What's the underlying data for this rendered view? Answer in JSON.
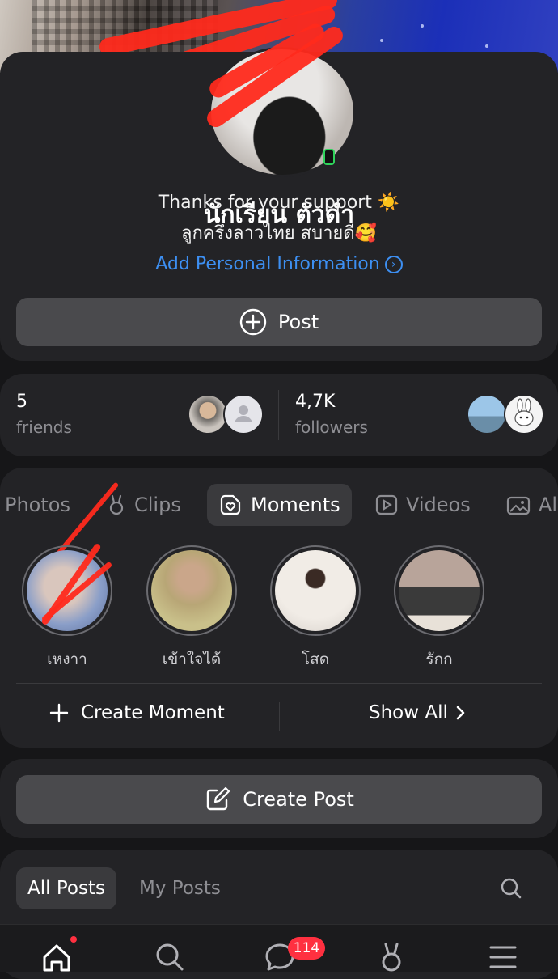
{
  "profile": {
    "name": "นักเรียน ตัวดำ",
    "bio_line1": "Thanks for your support ☀️",
    "bio_line2": "ลูกครึ่งลาวไทย สบายดี🥰",
    "add_info_label": "Add Personal Information",
    "post_button": "Post"
  },
  "stats": {
    "friends_count": "5",
    "friends_label": "friends",
    "followers_count": "4,7K",
    "followers_label": "followers"
  },
  "tabs": [
    {
      "label": "Photos",
      "icon": "photos-icon"
    },
    {
      "label": "Clips",
      "icon": "clips-icon"
    },
    {
      "label": "Moments",
      "icon": "moments-icon",
      "active": true
    },
    {
      "label": "Videos",
      "icon": "videos-icon"
    },
    {
      "label": "Al",
      "icon": "albums-icon"
    }
  ],
  "moments": [
    {
      "label": "เหงาา",
      "color": "#b9a7a0"
    },
    {
      "label": "เข้าใจได้",
      "color": "#c4b48a"
    },
    {
      "label": "โสด",
      "color": "#e8e2dc"
    },
    {
      "label": "รักก",
      "color": "#9c8c86"
    }
  ],
  "moment_actions": {
    "create_label": "Create Moment",
    "show_all_label": "Show All"
  },
  "create_post_label": "Create Post",
  "post_filters": {
    "all_posts": "All Posts",
    "my_posts": "My Posts"
  },
  "nav": {
    "messages_badge": "114",
    "items": [
      "home-icon",
      "search-icon",
      "messages-icon",
      "clips-icon",
      "menu-icon"
    ]
  },
  "colors": {
    "accent_link": "#3d8ff2",
    "badge": "#ff3040",
    "online": "#2fd35b",
    "card_bg": "#232326"
  }
}
